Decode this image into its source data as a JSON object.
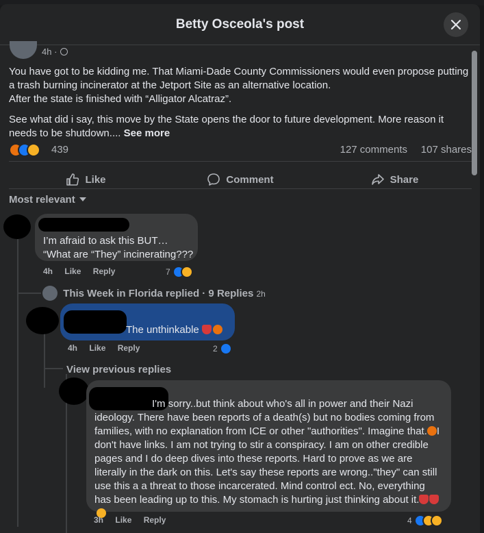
{
  "header": {
    "title": "Betty Osceola's post"
  },
  "post": {
    "time": "4h ·",
    "paragraphs": [
      "You have got to be kidding me. That Miami-Dade County Commissioners would even propose putting a trash burning incinerator at the Jetport Site as an alternative location.",
      "After the state is finished with “Alligator Alcatraz”.",
      "See what did i say, this move by the State opens the door to future development. More reason it needs to be shutdown.... "
    ],
    "see_more": "See more",
    "reaction_count": "439",
    "comments_count": "127 comments",
    "shares_count": "107 shares"
  },
  "actions": {
    "like": "Like",
    "comment": "Comment",
    "share": "Share"
  },
  "sort": {
    "label": "Most relevant"
  },
  "comments": [
    {
      "text_line1": "I’m afraid to ask this BUT…",
      "text_line2": "“What are “They” incinerating???",
      "time": "4h",
      "like": "Like",
      "reply": "Reply",
      "reaction_count": "7"
    }
  ],
  "thread": {
    "replied_name": "This Week in Florida replied · 9 Replies",
    "replied_time": "2h",
    "reply1": {
      "text": "The unthinkable",
      "time": "4h",
      "like": "Like",
      "reply": "Reply",
      "reaction_count": "2"
    },
    "view_previous": "View previous replies",
    "reply2": {
      "text": "I'm sorry..but think about who's all in power and their Nazi ideology. There have been reports of a death(s) but no bodies coming from families, with no explanation from ICE or other \"authorities\". Imagine that.",
      "text_b": "I don't have links. I am not trying to stir a conspiracy. I am on other credible pages and I do deep dives into these reports. Hard to prove as we are literally in the dark on this. Let's say these reports are wrong..\"they\" can still use this a a threat to those incarcerated. Mind control ect. No, everything has been leading up to this. My stomach is hurting just thinking about it.",
      "time": "3h",
      "like": "Like",
      "reply": "Reply",
      "reaction_count": "4"
    }
  },
  "colors": {
    "bg": "#242526",
    "bubble": "#3a3b3c",
    "accent": "#1877f2",
    "text": "#e4e6eb",
    "muted": "#b0b3b8"
  }
}
